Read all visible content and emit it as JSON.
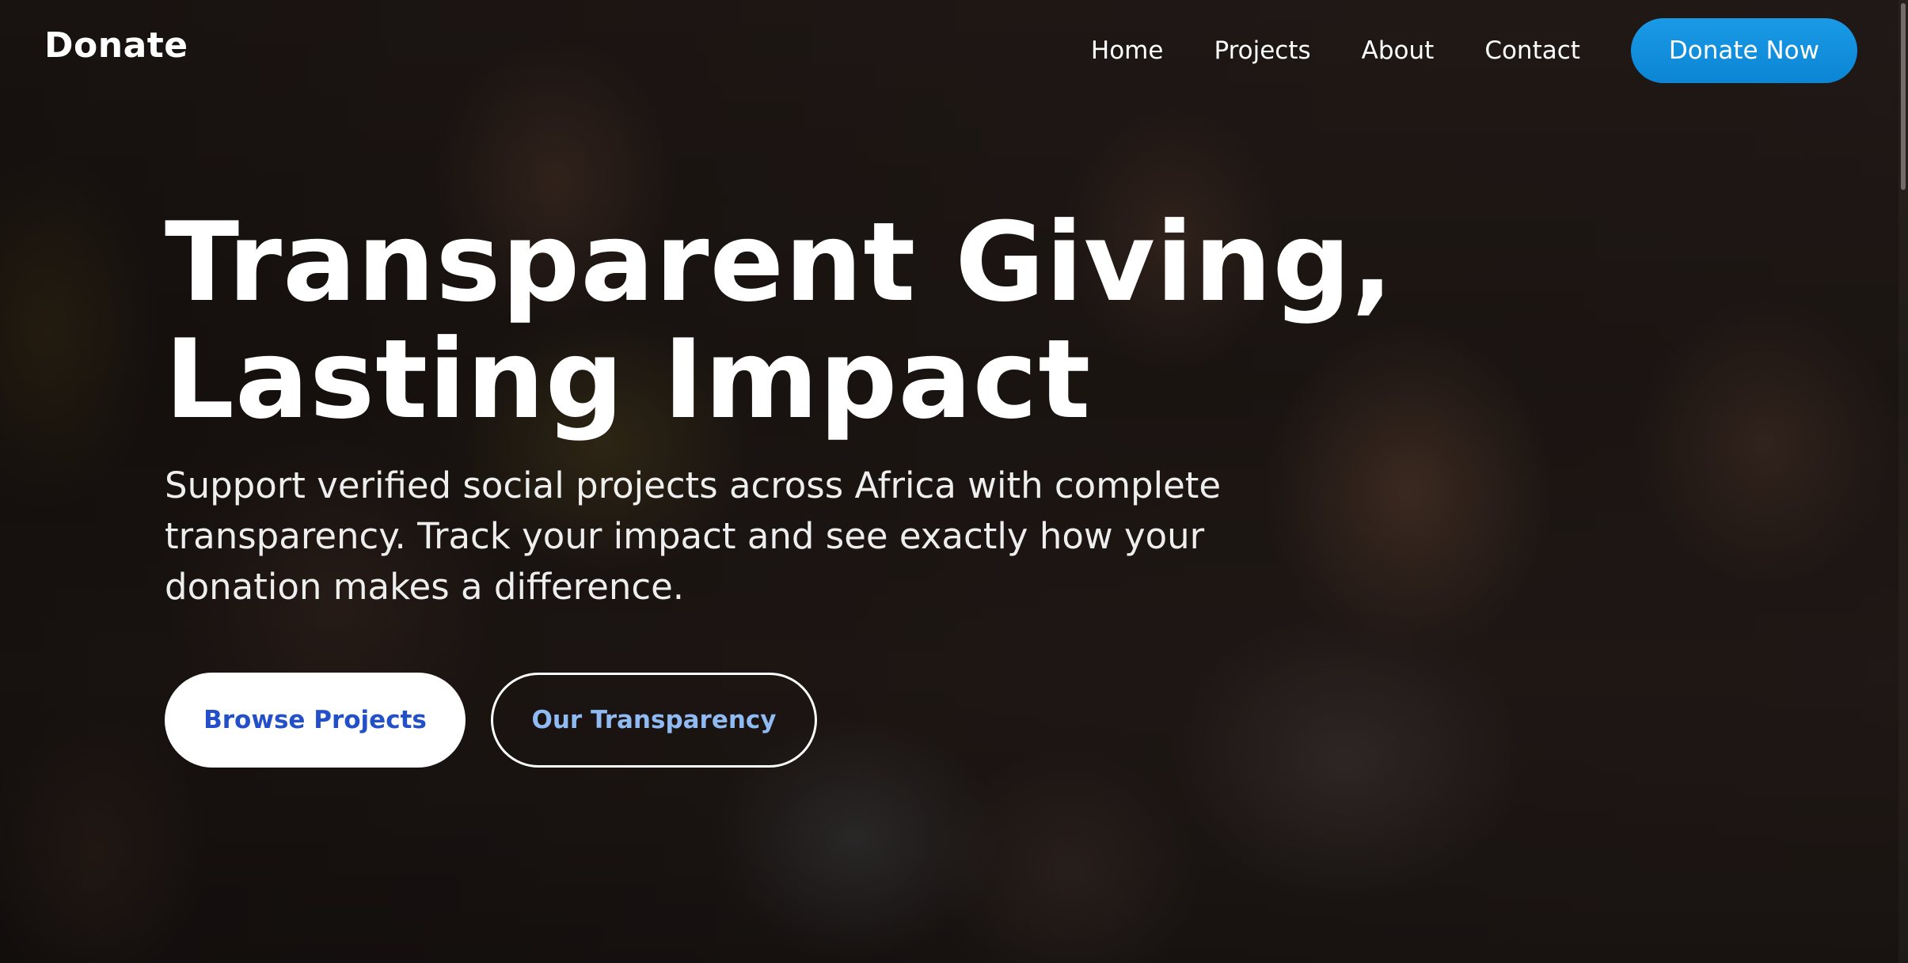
{
  "nav": {
    "brand": "Donate",
    "links": [
      {
        "label": "Home"
      },
      {
        "label": "Projects"
      },
      {
        "label": "About"
      },
      {
        "label": "Contact"
      }
    ],
    "cta_label": "Donate Now"
  },
  "hero": {
    "title_line1": "Transparent Giving,",
    "title_line2": "Lasting Impact",
    "subtitle": "Support verified social projects across Africa with complete transparency. Track your impact and see exactly how your donation makes a difference.",
    "primary_button": "Browse Projects",
    "secondary_button": "Our Transparency",
    "background_image": "hero-photo-children"
  },
  "colors": {
    "accent": "#0b8ad8",
    "primary_button_text": "#2350c8",
    "secondary_button_text": "#8fbaf2"
  }
}
